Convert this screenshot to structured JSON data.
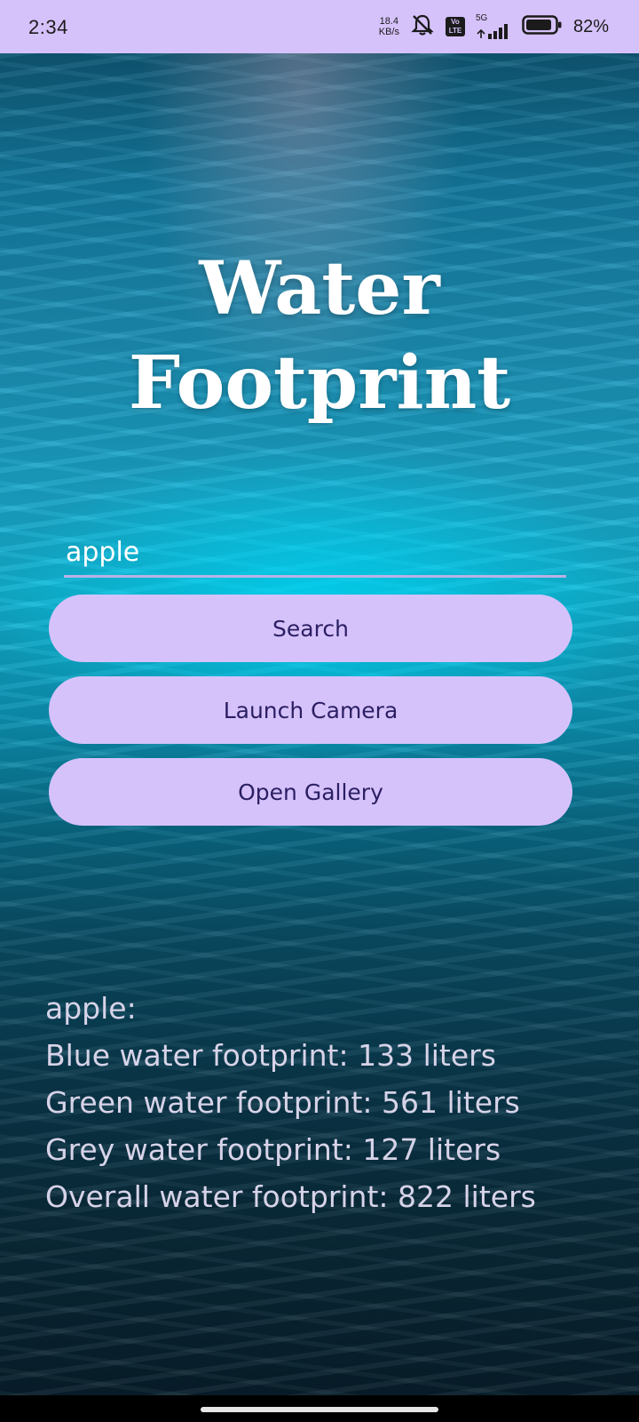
{
  "status_bar": {
    "time": "2:34",
    "net_speed_value": "18.4",
    "net_speed_unit": "KB/s",
    "volte_line1": "Vo",
    "volte_line2": "LTE",
    "network_type": "5G",
    "battery_percent": "82%",
    "icons": [
      "mute-bell-icon",
      "volte-icon",
      "signal-icon",
      "battery-icon"
    ]
  },
  "app": {
    "title_line1": "Water",
    "title_line2": "Footprint"
  },
  "search": {
    "value": "apple",
    "placeholder": ""
  },
  "buttons": {
    "search": "Search",
    "camera": "Launch Camera",
    "gallery": "Open Gallery"
  },
  "results": {
    "item": "apple:",
    "blue": "Blue water footprint: 133 liters",
    "green": "Green water footprint: 561 liters",
    "grey": "Grey water footprint: 127 liters",
    "overall": "Overall water footprint: 822 liters"
  },
  "colors": {
    "status_bar": "#d6c2fb",
    "button_bg": "#d6c2fb",
    "button_text": "#2b1f63",
    "title": "#ffffff",
    "result_text": "#d7d3e8"
  }
}
